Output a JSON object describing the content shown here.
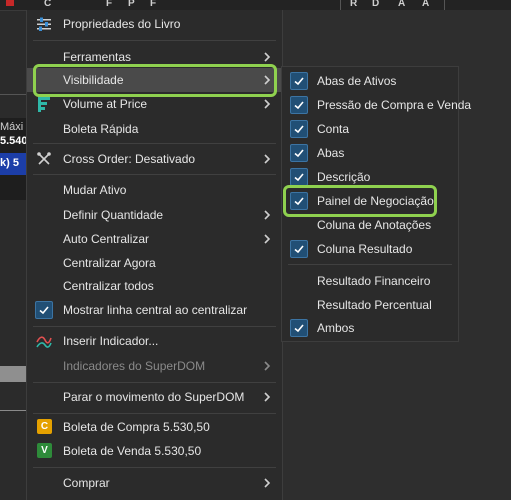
{
  "toolbar": {
    "letters": [
      "C",
      "F",
      "P",
      "F",
      "R",
      "D",
      "A",
      "A"
    ]
  },
  "background": {
    "maxima_label": "Máxi",
    "price_fragment": "5.540",
    "blue_fragment": "k) 5",
    "red_marker_color": "#c62828"
  },
  "menu": {
    "items": [
      {
        "label": "Propriedades do Livro"
      },
      {
        "label": "Ferramentas"
      },
      {
        "label": "Visibilidade"
      },
      {
        "label": "Volume at Price"
      },
      {
        "label": "Boleta Rápida"
      },
      {
        "label": "Cross Order: Desativado"
      },
      {
        "label": "Mudar Ativo"
      },
      {
        "label": "Definir Quantidade"
      },
      {
        "label": "Auto Centralizar"
      },
      {
        "label": "Centralizar Agora"
      },
      {
        "label": "Centralizar todos"
      },
      {
        "label": "Mostrar linha central ao centralizar"
      },
      {
        "label": "Inserir Indicador..."
      },
      {
        "label": "Indicadores do SuperDOM"
      },
      {
        "label": "Parar o movimento do SuperDOM"
      },
      {
        "label": "Boleta de Compra 5.530,50",
        "badge": "C",
        "badge_color": "#e5a100"
      },
      {
        "label": "Boleta de Venda 5.530,50",
        "badge": "V",
        "badge_color": "#2e8b3a"
      },
      {
        "label": "Comprar"
      }
    ]
  },
  "submenu": {
    "items": [
      {
        "label": "Abas de Ativos",
        "checked": true
      },
      {
        "label": "Pressão de Compra e Venda",
        "checked": true
      },
      {
        "label": "Conta",
        "checked": true
      },
      {
        "label": "Abas",
        "checked": true
      },
      {
        "label": "Descrição",
        "checked": true
      },
      {
        "label": "Painel de Negociação",
        "checked": true
      },
      {
        "label": "Coluna de Anotações",
        "checked": false
      },
      {
        "label": "Coluna Resultado",
        "checked": true
      },
      {
        "label": "Resultado Financeiro",
        "checked": false
      },
      {
        "label": "Resultado Percentual",
        "checked": false
      },
      {
        "label": "Ambos",
        "checked": true
      }
    ]
  },
  "colors": {
    "menu_bg": "#2b2b2b",
    "highlight_ring": "#8fd14f",
    "check_bg": "#214f75",
    "hover_bg": "#4a4a4a"
  }
}
